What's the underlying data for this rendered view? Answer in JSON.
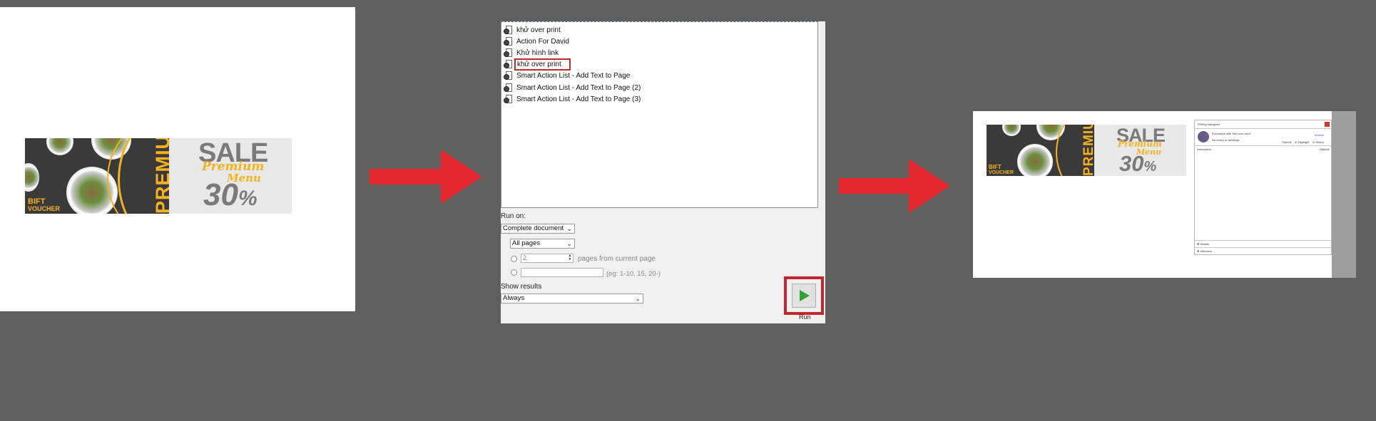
{
  "left_banner": {
    "premium": "PREMIUM",
    "gift_line1": "BIFT",
    "gift_line2": "VOUCHER",
    "sale": "SALE",
    "script_line1": "Premium",
    "script_line2": "Menu",
    "number": "30",
    "percent": "%"
  },
  "action_list": {
    "items": [
      {
        "label": "khử over print",
        "selected": false
      },
      {
        "label": "Action For David",
        "selected": false
      },
      {
        "label": "Khử hình link",
        "selected": false
      },
      {
        "label": "khử over print",
        "selected": true
      },
      {
        "label": "Smart Action List - Add Text to Page",
        "selected": false
      },
      {
        "label": "Smart Action List - Add Text to Page (2)",
        "selected": false
      },
      {
        "label": "Smart Action List - Add Text to Page (3)",
        "selected": false
      }
    ]
  },
  "run_on": {
    "label": "Run on:",
    "scope_value": "Complete document",
    "pages_value": "All pages",
    "page_count_value": "2",
    "page_count_suffix": "pages from current page",
    "range_hint": "(eg: 1-10, 15, 20-)"
  },
  "show_results": {
    "label": "Show results",
    "value": "Always"
  },
  "run_button": {
    "label": "Run",
    "color": "#2ea62e",
    "highlight_color": "#c1272d"
  },
  "preflight": {
    "title": "PitStop Navigator",
    "processed": "Processed with 'khử over print'",
    "no_errors": "No errors or warnings",
    "link": "Actions",
    "objects_label": "Objects",
    "highlight_label": "Highlight",
    "select_label": "Select",
    "col_description": "Description",
    "col_objects": "Objects",
    "details_label": "Details",
    "selection_label": "Selection"
  },
  "colors": {
    "background": "#5f5f5f",
    "arrow": "#e3262c",
    "accent_yellow": "#f5b21d"
  }
}
